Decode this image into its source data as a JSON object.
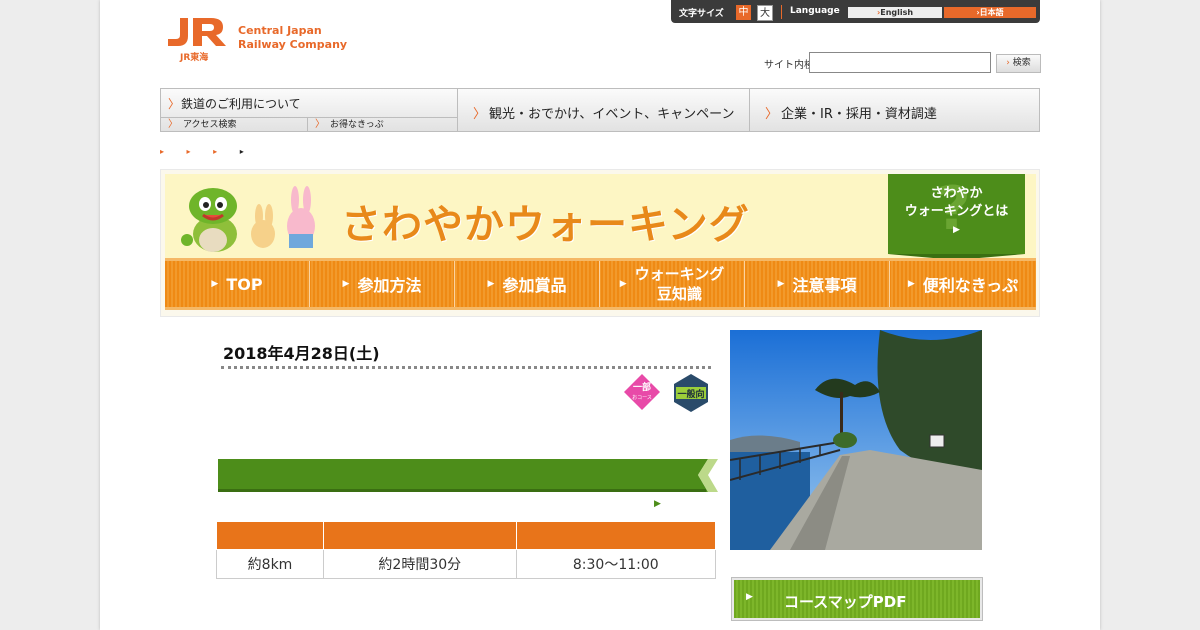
{
  "header": {
    "logo_mark": "JR",
    "logo_sub": "JR東海",
    "logo_line1": "Central Japan",
    "logo_line2": "Railway Company",
    "font_size_label": "文字サイズ",
    "font_mid": "中",
    "font_big": "大",
    "language_label": "Language",
    "lang_en": "English",
    "lang_jp": "日本語",
    "search_label": "サイト内検索",
    "search_value": "",
    "search_button": "検索"
  },
  "gnav": {
    "railway": "鉄道のご利用について",
    "access": "アクセス検索",
    "tickets": "お得なきっぷ",
    "tourism": "観光・おでかけ、イベント、キャンペーン",
    "corporate": "企業・IR・採用・資材調達"
  },
  "breadcrumb_arrows": "▸ ▸ ▸ ",
  "banner": {
    "title": "さわやかウォーキング",
    "whatis_line1": "さわやか",
    "whatis_line2": "ウォーキングとは",
    "tabs": [
      "TOP",
      "参加方法",
      "参加賞品",
      "ウォーキング豆知識",
      "注意事項",
      "便利なきっぷ"
    ],
    "tab_knowledge_l1": "ウォーキング",
    "tab_knowledge_l2": "豆知識"
  },
  "event": {
    "date": "2018年4月28日(土)",
    "badge1": "一部",
    "badge1_sub": "おコース",
    "badge2": "一般向",
    "title": "",
    "course_name": "",
    "detail_link": "",
    "table_headers": [
      "",
      "",
      ""
    ],
    "table_values": [
      "約8km",
      "約2時間30分",
      "8:30～11:00"
    ],
    "caption": "",
    "pdf_button": "コースマップPDF"
  },
  "colors": {
    "brand_orange": "#e8692a",
    "tab_orange": "#ef8a14",
    "green": "#4d8d1a",
    "table_header": "#e8741a"
  }
}
